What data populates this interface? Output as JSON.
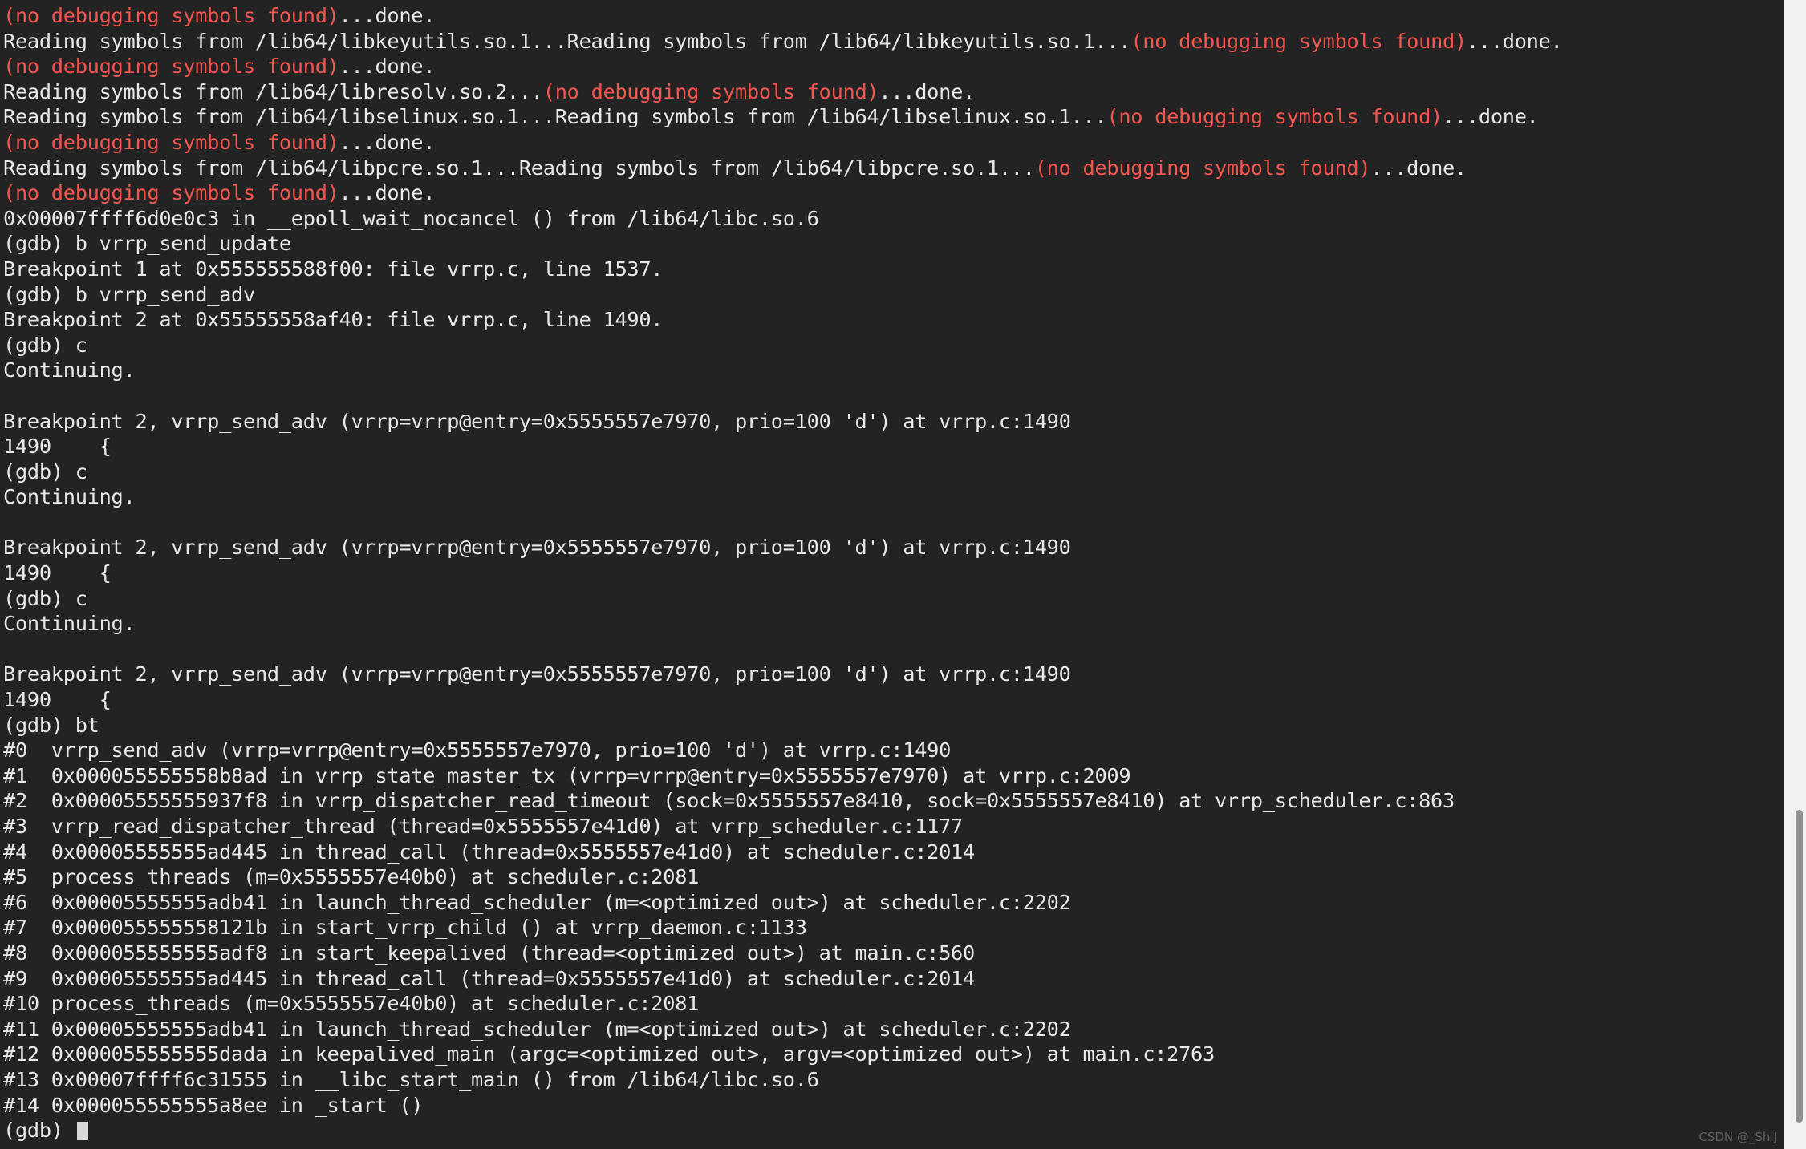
{
  "terminal": {
    "program": "gdb",
    "background_color": "#232323",
    "foreground_color": "#e8e8e8",
    "error_color": "#f4554f",
    "prompt": "(gdb) ",
    "cursor": "block",
    "scrollbar": {
      "track_color": "#f0f0f0",
      "thumb_color": "#8f8f8f"
    }
  },
  "watermark": "CSDN @_ShiJ",
  "lines": [
    {
      "id": "l01",
      "segments": [
        {
          "text": "(no debugging symbols found)",
          "color": "red"
        },
        {
          "text": "...done.",
          "color": "plain"
        }
      ]
    },
    {
      "id": "l02",
      "segments": [
        {
          "text": "Reading symbols from /lib64/libkeyutils.so.1...Reading symbols from /lib64/libkeyutils.so.1...",
          "color": "plain"
        },
        {
          "text": "(no debugging symbols found)",
          "color": "red"
        },
        {
          "text": "...done.",
          "color": "plain"
        }
      ]
    },
    {
      "id": "l03",
      "segments": [
        {
          "text": "(no debugging symbols found)",
          "color": "red"
        },
        {
          "text": "...done.",
          "color": "plain"
        }
      ]
    },
    {
      "id": "l04",
      "segments": [
        {
          "text": "Reading symbols from /lib64/libresolv.so.2...",
          "color": "plain"
        },
        {
          "text": "(no debugging symbols found)",
          "color": "red"
        },
        {
          "text": "...done.",
          "color": "plain"
        }
      ]
    },
    {
      "id": "l05",
      "segments": [
        {
          "text": "Reading symbols from /lib64/libselinux.so.1...Reading symbols from /lib64/libselinux.so.1...",
          "color": "plain"
        },
        {
          "text": "(no debugging symbols found)",
          "color": "red"
        },
        {
          "text": "...done.",
          "color": "plain"
        }
      ]
    },
    {
      "id": "l06",
      "segments": [
        {
          "text": "(no debugging symbols found)",
          "color": "red"
        },
        {
          "text": "...done.",
          "color": "plain"
        }
      ]
    },
    {
      "id": "l07",
      "segments": [
        {
          "text": "Reading symbols from /lib64/libpcre.so.1...Reading symbols from /lib64/libpcre.so.1...",
          "color": "plain"
        },
        {
          "text": "(no debugging symbols found)",
          "color": "red"
        },
        {
          "text": "...done.",
          "color": "plain"
        }
      ]
    },
    {
      "id": "l08",
      "segments": [
        {
          "text": "(no debugging symbols found)",
          "color": "red"
        },
        {
          "text": "...done.",
          "color": "plain"
        }
      ]
    },
    {
      "id": "l09",
      "segments": [
        {
          "text": "0x00007ffff6d0e0c3 in __epoll_wait_nocancel () from /lib64/libc.so.6",
          "color": "plain"
        }
      ]
    },
    {
      "id": "l10",
      "segments": [
        {
          "text": "(gdb) b vrrp_send_update",
          "color": "plain"
        }
      ]
    },
    {
      "id": "l11",
      "segments": [
        {
          "text": "Breakpoint 1 at 0x555555588f00: file vrrp.c, line 1537.",
          "color": "plain"
        }
      ]
    },
    {
      "id": "l12",
      "segments": [
        {
          "text": "(gdb) b vrrp_send_adv",
          "color": "plain"
        }
      ]
    },
    {
      "id": "l13",
      "segments": [
        {
          "text": "Breakpoint 2 at 0x55555558af40: file vrrp.c, line 1490.",
          "color": "plain"
        }
      ]
    },
    {
      "id": "l14",
      "segments": [
        {
          "text": "(gdb) c",
          "color": "plain"
        }
      ]
    },
    {
      "id": "l15",
      "segments": [
        {
          "text": "Continuing.",
          "color": "plain"
        }
      ]
    },
    {
      "id": "l16",
      "segments": [
        {
          "text": "",
          "color": "plain"
        }
      ]
    },
    {
      "id": "l17",
      "segments": [
        {
          "text": "Breakpoint 2, vrrp_send_adv (vrrp=vrrp@entry=0x5555557e7970, prio=100 'd') at vrrp.c:1490",
          "color": "plain"
        }
      ]
    },
    {
      "id": "l18",
      "segments": [
        {
          "text": "1490    {",
          "color": "plain"
        }
      ]
    },
    {
      "id": "l19",
      "segments": [
        {
          "text": "(gdb) c",
          "color": "plain"
        }
      ]
    },
    {
      "id": "l20",
      "segments": [
        {
          "text": "Continuing.",
          "color": "plain"
        }
      ]
    },
    {
      "id": "l21",
      "segments": [
        {
          "text": "",
          "color": "plain"
        }
      ]
    },
    {
      "id": "l22",
      "segments": [
        {
          "text": "Breakpoint 2, vrrp_send_adv (vrrp=vrrp@entry=0x5555557e7970, prio=100 'd') at vrrp.c:1490",
          "color": "plain"
        }
      ]
    },
    {
      "id": "l23",
      "segments": [
        {
          "text": "1490    {",
          "color": "plain"
        }
      ]
    },
    {
      "id": "l24",
      "segments": [
        {
          "text": "(gdb) c",
          "color": "plain"
        }
      ]
    },
    {
      "id": "l25",
      "segments": [
        {
          "text": "Continuing.",
          "color": "plain"
        }
      ]
    },
    {
      "id": "l26",
      "segments": [
        {
          "text": "",
          "color": "plain"
        }
      ]
    },
    {
      "id": "l27",
      "segments": [
        {
          "text": "Breakpoint 2, vrrp_send_adv (vrrp=vrrp@entry=0x5555557e7970, prio=100 'd') at vrrp.c:1490",
          "color": "plain"
        }
      ]
    },
    {
      "id": "l28",
      "segments": [
        {
          "text": "1490    {",
          "color": "plain"
        }
      ]
    },
    {
      "id": "l29",
      "segments": [
        {
          "text": "(gdb) bt",
          "color": "plain"
        }
      ]
    },
    {
      "id": "l30",
      "segments": [
        {
          "text": "#0  vrrp_send_adv (vrrp=vrrp@entry=0x5555557e7970, prio=100 'd') at vrrp.c:1490",
          "color": "plain"
        }
      ]
    },
    {
      "id": "l31",
      "segments": [
        {
          "text": "#1  0x000055555558b8ad in vrrp_state_master_tx (vrrp=vrrp@entry=0x5555557e7970) at vrrp.c:2009",
          "color": "plain"
        }
      ]
    },
    {
      "id": "l32",
      "segments": [
        {
          "text": "#2  0x00005555555937f8 in vrrp_dispatcher_read_timeout (sock=0x5555557e8410, sock=0x5555557e8410) at vrrp_scheduler.c:863",
          "color": "plain"
        }
      ]
    },
    {
      "id": "l33",
      "segments": [
        {
          "text": "#3  vrrp_read_dispatcher_thread (thread=0x5555557e41d0) at vrrp_scheduler.c:1177",
          "color": "plain"
        }
      ]
    },
    {
      "id": "l34",
      "segments": [
        {
          "text": "#4  0x00005555555ad445 in thread_call (thread=0x5555557e41d0) at scheduler.c:2014",
          "color": "plain"
        }
      ]
    },
    {
      "id": "l35",
      "segments": [
        {
          "text": "#5  process_threads (m=0x5555557e40b0) at scheduler.c:2081",
          "color": "plain"
        }
      ]
    },
    {
      "id": "l36",
      "segments": [
        {
          "text": "#6  0x00005555555adb41 in launch_thread_scheduler (m=<optimized out>) at scheduler.c:2202",
          "color": "plain"
        }
      ]
    },
    {
      "id": "l37",
      "segments": [
        {
          "text": "#7  0x000055555558121b in start_vrrp_child () at vrrp_daemon.c:1133",
          "color": "plain"
        }
      ]
    },
    {
      "id": "l38",
      "segments": [
        {
          "text": "#8  0x000055555555adf8 in start_keepalived (thread=<optimized out>) at main.c:560",
          "color": "plain"
        }
      ]
    },
    {
      "id": "l39",
      "segments": [
        {
          "text": "#9  0x00005555555ad445 in thread_call (thread=0x5555557e41d0) at scheduler.c:2014",
          "color": "plain"
        }
      ]
    },
    {
      "id": "l40",
      "segments": [
        {
          "text": "#10 process_threads (m=0x5555557e40b0) at scheduler.c:2081",
          "color": "plain"
        }
      ]
    },
    {
      "id": "l41",
      "segments": [
        {
          "text": "#11 0x00005555555adb41 in launch_thread_scheduler (m=<optimized out>) at scheduler.c:2202",
          "color": "plain"
        }
      ]
    },
    {
      "id": "l42",
      "segments": [
        {
          "text": "#12 0x000055555555dada in keepalived_main (argc=<optimized out>, argv=<optimized out>) at main.c:2763",
          "color": "plain"
        }
      ]
    },
    {
      "id": "l43",
      "segments": [
        {
          "text": "#13 0x00007ffff6c31555 in __libc_start_main () from /lib64/libc.so.6",
          "color": "plain"
        }
      ]
    },
    {
      "id": "l44",
      "segments": [
        {
          "text": "#14 0x000055555555a8ee in _start ()",
          "color": "plain"
        }
      ]
    },
    {
      "id": "l45",
      "segments": [
        {
          "text": "(gdb) ",
          "color": "plain"
        }
      ],
      "cursor": true
    }
  ]
}
